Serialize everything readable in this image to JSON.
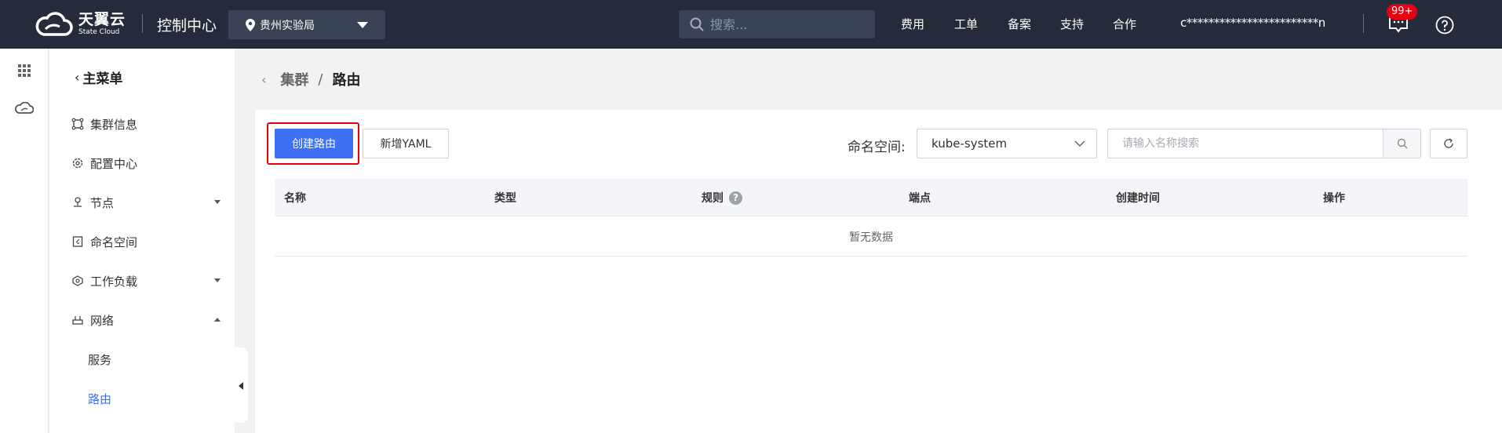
{
  "topbar": {
    "brand_cn": "天翼云",
    "brand_en": "State Cloud",
    "console_title": "控制中心",
    "region": "贵州实验局",
    "search_placeholder": "搜索...",
    "nav": [
      "费用",
      "工单",
      "备案",
      "支持",
      "合作"
    ],
    "account": "c************************n",
    "notification_badge": "99+",
    "icons": [
      "cloud-logo-icon",
      "location-pin-icon",
      "caret-down-icon",
      "search-icon",
      "message-icon",
      "help-icon"
    ]
  },
  "strip": {
    "icons": [
      "apps-grid-icon",
      "cloud-icon"
    ]
  },
  "sidebar": {
    "back_label": "主菜单",
    "items": [
      {
        "label": "集群信息",
        "icon": "cluster-icon"
      },
      {
        "label": "配置中心",
        "icon": "config-gear-icon"
      },
      {
        "label": "节点",
        "icon": "node-icon",
        "expand": "collapsed"
      },
      {
        "label": "命名空间",
        "icon": "namespace-icon"
      },
      {
        "label": "工作负载",
        "icon": "workload-icon",
        "expand": "collapsed"
      },
      {
        "label": "网络",
        "icon": "network-icon",
        "expand": "expanded"
      }
    ],
    "sub_items": [
      {
        "label": "服务",
        "active": false
      },
      {
        "label": "路由",
        "active": true
      }
    ]
  },
  "breadcrumb": {
    "parent": "集群",
    "separator": "/",
    "current": "路由"
  },
  "toolbar": {
    "create_label": "创建路由",
    "yaml_label": "新增YAML",
    "namespace_label": "命名空间:",
    "namespace_value": "kube-system",
    "name_search_placeholder": "请输入名称搜索"
  },
  "table": {
    "columns": [
      "名称",
      "类型",
      "规则",
      "端点",
      "创建时间",
      "操作"
    ],
    "rule_help": "?",
    "empty_text": "暂无数据"
  },
  "colors": {
    "topbar_bg": "#262b3c",
    "primary": "#3e6ff5",
    "highlight_border": "#e60012",
    "badge": "#e60012"
  }
}
